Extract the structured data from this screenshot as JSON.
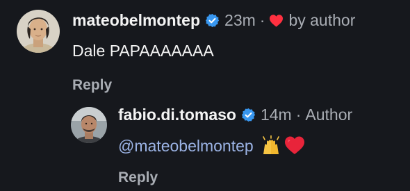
{
  "comments": [
    {
      "username": "mateobelmontep",
      "time": "23m",
      "liked_by": "by author",
      "text": "Dale PAPAAAAAAA",
      "reply_label": "Reply",
      "verified": true,
      "heart_color": "#ff3040"
    },
    {
      "username": "fabio.di.tomaso",
      "time": "14m",
      "tag": "Author",
      "mention": "@mateobelmontep",
      "emojis": [
        "raising-hands-icon",
        "red-heart-icon"
      ],
      "reply_label": "Reply",
      "verified": true
    }
  ],
  "colors": {
    "background": "#16181d",
    "text_primary": "#f4f4f4",
    "text_secondary": "#a9adb4",
    "mention": "#9cb4e6",
    "verified_blue": "#3897f0",
    "heart_red": "#ff3040"
  },
  "separator": "·"
}
